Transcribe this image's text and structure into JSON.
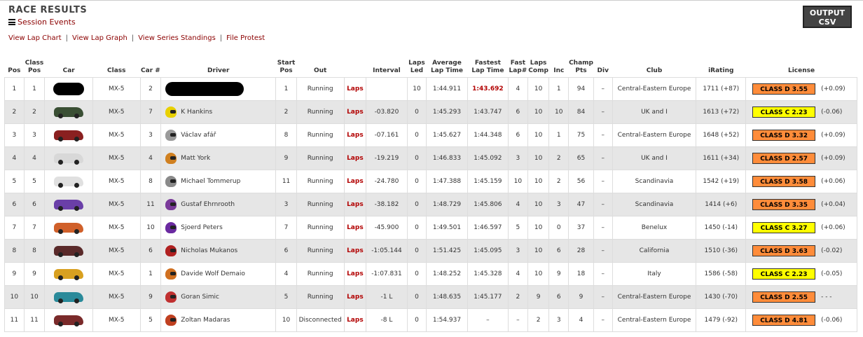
{
  "header": {
    "title": "RACE RESULTS",
    "session_events_label": "Session Events",
    "output_csv_line1": "OUTPUT",
    "output_csv_line2": "CSV"
  },
  "links": [
    "View Lap Chart",
    "View Lap Graph",
    "View Series Standings",
    "File Protest"
  ],
  "link_separator": "|",
  "columns": [
    {
      "l1": "",
      "l2": "Pos"
    },
    {
      "l1": "Class",
      "l2": "Pos"
    },
    {
      "l1": "",
      "l2": "Car"
    },
    {
      "l1": "",
      "l2": "Class"
    },
    {
      "l1": "",
      "l2": "Car #"
    },
    {
      "l1": "",
      "l2": "Driver"
    },
    {
      "l1": "Start",
      "l2": "Pos"
    },
    {
      "l1": "",
      "l2": "Out"
    },
    {
      "l1": "",
      "l2": ""
    },
    {
      "l1": "",
      "l2": "Interval"
    },
    {
      "l1": "Laps",
      "l2": "Led"
    },
    {
      "l1": "Average",
      "l2": "Lap Time"
    },
    {
      "l1": "Fastest",
      "l2": "Lap Time"
    },
    {
      "l1": "Fast",
      "l2": "Lap#"
    },
    {
      "l1": "Laps",
      "l2": "Comp"
    },
    {
      "l1": "",
      "l2": "Inc"
    },
    {
      "l1": "Champ",
      "l2": "Pts"
    },
    {
      "l1": "",
      "l2": "Div"
    },
    {
      "l1": "",
      "l2": "Club"
    },
    {
      "l1": "",
      "l2": "iRating"
    },
    {
      "l1": "",
      "l2": "License"
    }
  ],
  "colors": {
    "link": "#8b0000",
    "laps_link": "#b20000",
    "class_d": "#ff8c3a",
    "class_c": "#ffff00",
    "row_alt": "#e6e6e6"
  },
  "rows": [
    {
      "pos": "1",
      "class_pos": "1",
      "car_color": "#111111",
      "car_redacted": true,
      "class": "MX-5",
      "car_num": "2",
      "driver": "",
      "driver_redacted": true,
      "helmet_color": "",
      "start_pos": "1",
      "out": "Running",
      "laps_link": "Laps",
      "interval": "",
      "laps_led": "10",
      "avg_lap": "1:44.911",
      "fastest_lap": "1:43.692",
      "fastest_highlight": true,
      "fast_lap_num": "4",
      "laps_comp": "10",
      "inc": "1",
      "champ_pts": "94",
      "div": "–",
      "club": "Central-Eastern Europe",
      "irating": "1711 (+87)",
      "license": "CLASS D 3.55",
      "license_class": "D",
      "license_change": "(+0.09)"
    },
    {
      "pos": "2",
      "class_pos": "2",
      "car_color": "#3a4f34",
      "car_redacted": false,
      "class": "MX-5",
      "car_num": "7",
      "driver": "K Hankins",
      "driver_redacted": false,
      "helmet_color": "#e8d000",
      "start_pos": "2",
      "out": "Running",
      "laps_link": "Laps",
      "interval": "-03.820",
      "laps_led": "0",
      "avg_lap": "1:45.293",
      "fastest_lap": "1:43.747",
      "fastest_highlight": false,
      "fast_lap_num": "6",
      "laps_comp": "10",
      "inc": "10",
      "champ_pts": "84",
      "div": "–",
      "club": "UK and I",
      "irating": "1613 (+72)",
      "license": "CLASS C 2.23",
      "license_class": "C",
      "license_change": "(-0.06)"
    },
    {
      "pos": "3",
      "class_pos": "3",
      "car_color": "#8a2020",
      "car_redacted": false,
      "class": "MX-5",
      "car_num": "3",
      "driver": "Václav afář",
      "driver_redacted": false,
      "helmet_color": "#9a9a9a",
      "start_pos": "8",
      "out": "Running",
      "laps_link": "Laps",
      "interval": "-07.161",
      "laps_led": "0",
      "avg_lap": "1:45.627",
      "fastest_lap": "1:44.348",
      "fastest_highlight": false,
      "fast_lap_num": "6",
      "laps_comp": "10",
      "inc": "1",
      "champ_pts": "75",
      "div": "–",
      "club": "Central-Eastern Europe",
      "irating": "1648 (+52)",
      "license": "CLASS D 3.32",
      "license_class": "D",
      "license_change": "(+0.09)"
    },
    {
      "pos": "4",
      "class_pos": "4",
      "car_color": "#d8d8d8",
      "car_redacted": false,
      "class": "MX-5",
      "car_num": "4",
      "driver": "Matt York",
      "driver_redacted": false,
      "helmet_color": "#d08020",
      "start_pos": "9",
      "out": "Running",
      "laps_link": "Laps",
      "interval": "-19.219",
      "laps_led": "0",
      "avg_lap": "1:46.833",
      "fastest_lap": "1:45.092",
      "fastest_highlight": false,
      "fast_lap_num": "3",
      "laps_comp": "10",
      "inc": "2",
      "champ_pts": "65",
      "div": "–",
      "club": "UK and I",
      "irating": "1611 (+34)",
      "license": "CLASS D 2.57",
      "license_class": "D",
      "license_change": "(+0.09)"
    },
    {
      "pos": "5",
      "class_pos": "5",
      "car_color": "#e0e0e0",
      "car_redacted": false,
      "class": "MX-5",
      "car_num": "8",
      "driver": "Michael Tommerup",
      "driver_redacted": false,
      "helmet_color": "#8a8a8a",
      "start_pos": "11",
      "out": "Running",
      "laps_link": "Laps",
      "interval": "-24.780",
      "laps_led": "0",
      "avg_lap": "1:47.388",
      "fastest_lap": "1:45.159",
      "fastest_highlight": false,
      "fast_lap_num": "10",
      "laps_comp": "10",
      "inc": "2",
      "champ_pts": "56",
      "div": "–",
      "club": "Scandinavia",
      "irating": "1542 (+19)",
      "license": "CLASS D 3.58",
      "license_class": "D",
      "license_change": "(+0.06)"
    },
    {
      "pos": "6",
      "class_pos": "6",
      "car_color": "#6a3fa8",
      "car_redacted": false,
      "class": "MX-5",
      "car_num": "11",
      "driver": "Gustaf Ehrnrooth",
      "driver_redacted": false,
      "helmet_color": "#7a3a9a",
      "start_pos": "3",
      "out": "Running",
      "laps_link": "Laps",
      "interval": "-38.182",
      "laps_led": "0",
      "avg_lap": "1:48.729",
      "fastest_lap": "1:45.806",
      "fastest_highlight": false,
      "fast_lap_num": "4",
      "laps_comp": "10",
      "inc": "3",
      "champ_pts": "47",
      "div": "–",
      "club": "Scandinavia",
      "irating": "1414 (+6)",
      "license": "CLASS D 3.35",
      "license_class": "D",
      "license_change": "(+0.04)"
    },
    {
      "pos": "7",
      "class_pos": "7",
      "car_color": "#d0602a",
      "car_redacted": false,
      "class": "MX-5",
      "car_num": "10",
      "driver": "Sjoerd Peters",
      "driver_redacted": false,
      "helmet_color": "#6a2aa0",
      "start_pos": "7",
      "out": "Running",
      "laps_link": "Laps",
      "interval": "-45.900",
      "laps_led": "0",
      "avg_lap": "1:49.501",
      "fastest_lap": "1:46.597",
      "fastest_highlight": false,
      "fast_lap_num": "5",
      "laps_comp": "10",
      "inc": "0",
      "champ_pts": "37",
      "div": "–",
      "club": "Benelux",
      "irating": "1450 (-14)",
      "license": "CLASS C 3.27",
      "license_class": "C",
      "license_change": "(+0.06)"
    },
    {
      "pos": "8",
      "class_pos": "8",
      "car_color": "#5a2a2a",
      "car_redacted": false,
      "class": "MX-5",
      "car_num": "6",
      "driver": "Nicholas Mukanos",
      "driver_redacted": false,
      "helmet_color": "#b02020",
      "start_pos": "6",
      "out": "Running",
      "laps_link": "Laps",
      "interval": "-1:05.144",
      "laps_led": "0",
      "avg_lap": "1:51.425",
      "fastest_lap": "1:45.095",
      "fastest_highlight": false,
      "fast_lap_num": "3",
      "laps_comp": "10",
      "inc": "6",
      "champ_pts": "28",
      "div": "–",
      "club": "California",
      "irating": "1510 (-36)",
      "license": "CLASS D 3.63",
      "license_class": "D",
      "license_change": "(-0.02)"
    },
    {
      "pos": "9",
      "class_pos": "9",
      "car_color": "#d8a020",
      "car_redacted": false,
      "class": "MX-5",
      "car_num": "1",
      "driver": "Davide Wolf Demaio",
      "driver_redacted": false,
      "helmet_color": "#d07020",
      "start_pos": "4",
      "out": "Running",
      "laps_link": "Laps",
      "interval": "-1:07.831",
      "laps_led": "0",
      "avg_lap": "1:48.252",
      "fastest_lap": "1:45.328",
      "fastest_highlight": false,
      "fast_lap_num": "4",
      "laps_comp": "10",
      "inc": "9",
      "champ_pts": "18",
      "div": "–",
      "club": "Italy",
      "irating": "1586 (-58)",
      "license": "CLASS C 2.23",
      "license_class": "C",
      "license_change": "(-0.05)"
    },
    {
      "pos": "10",
      "class_pos": "10",
      "car_color": "#2a8a9a",
      "car_redacted": false,
      "class": "MX-5",
      "car_num": "9",
      "driver": "Goran Simic",
      "driver_redacted": false,
      "helmet_color": "#c03030",
      "start_pos": "5",
      "out": "Running",
      "laps_link": "Laps",
      "interval": "-1 L",
      "laps_led": "0",
      "avg_lap": "1:48.635",
      "fastest_lap": "1:45.177",
      "fastest_highlight": false,
      "fast_lap_num": "2",
      "laps_comp": "9",
      "inc": "6",
      "champ_pts": "9",
      "div": "–",
      "club": "Central-Eastern Europe",
      "irating": "1430 (-70)",
      "license": "CLASS D 2.55",
      "license_class": "D",
      "license_change": "- - -"
    },
    {
      "pos": "11",
      "class_pos": "11",
      "car_color": "#7a2a2a",
      "car_redacted": false,
      "class": "MX-5",
      "car_num": "5",
      "driver": "Zoltan Madaras",
      "driver_redacted": false,
      "helmet_color": "#c04020",
      "start_pos": "10",
      "out": "Disconnected",
      "laps_link": "Laps",
      "interval": "-8 L",
      "laps_led": "0",
      "avg_lap": "1:54.937",
      "fastest_lap": "–",
      "fastest_highlight": false,
      "fast_lap_num": "–",
      "laps_comp": "2",
      "inc": "3",
      "champ_pts": "4",
      "div": "–",
      "club": "Central-Eastern Europe",
      "irating": "1479 (-92)",
      "license": "CLASS D 4.81",
      "license_class": "D",
      "license_change": "(-0.06)"
    }
  ]
}
